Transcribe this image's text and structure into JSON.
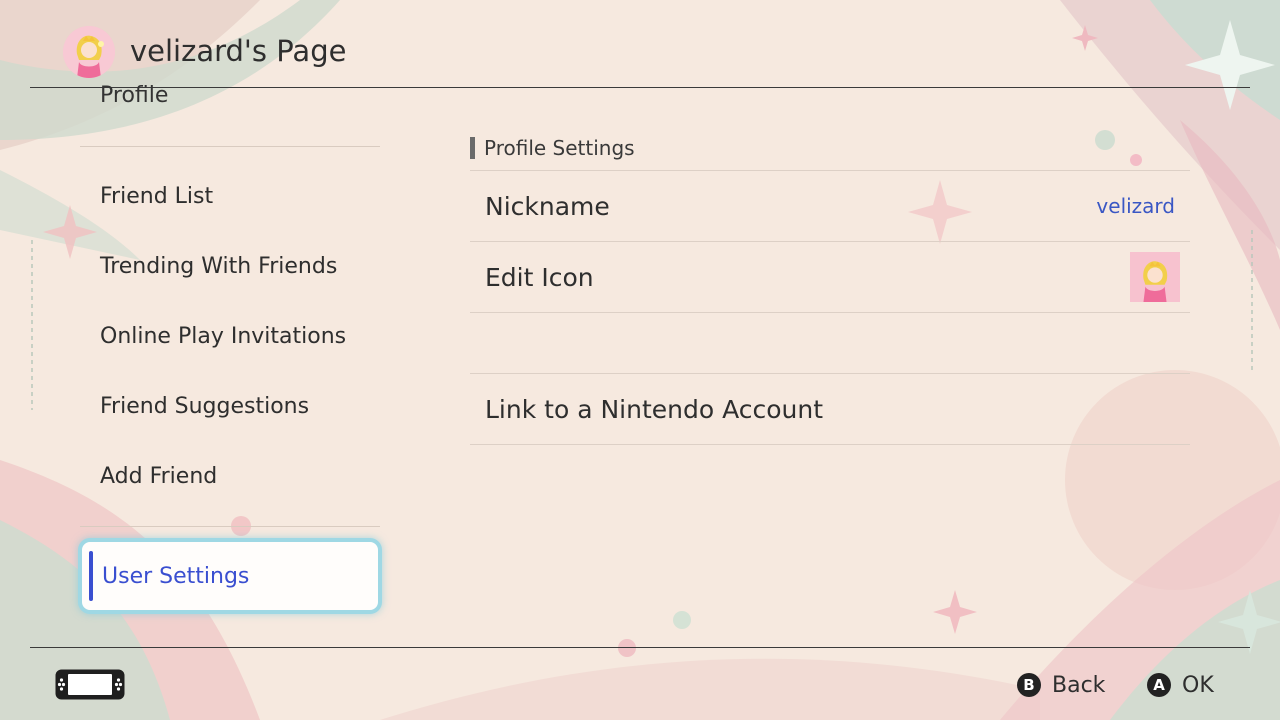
{
  "header": {
    "title": "velizard's Page",
    "avatar": "princess-peach-avatar"
  },
  "sidebar": {
    "profile_label": "Profile",
    "items": [
      {
        "label": "Friend List"
      },
      {
        "label": "Trending With Friends"
      },
      {
        "label": "Online Play Invitations"
      },
      {
        "label": "Friend Suggestions"
      },
      {
        "label": "Add Friend"
      }
    ],
    "selected": {
      "label": "User Settings"
    }
  },
  "main": {
    "section_title": "Profile Settings",
    "rows": [
      {
        "label": "Nickname",
        "value": "velizard"
      },
      {
        "label": "Edit Icon",
        "value_icon": "princess-peach-avatar"
      },
      {
        "label": ""
      },
      {
        "label": "Link to a Nintendo Account"
      }
    ]
  },
  "footer": {
    "back": {
      "button": "B",
      "label": "Back"
    },
    "ok": {
      "button": "A",
      "label": "OK"
    },
    "console_icon": "handheld-console-icon"
  },
  "colors": {
    "accent": "#3a4fd0",
    "selection_border": "#9fd8e4",
    "background": "#f6e9df"
  }
}
